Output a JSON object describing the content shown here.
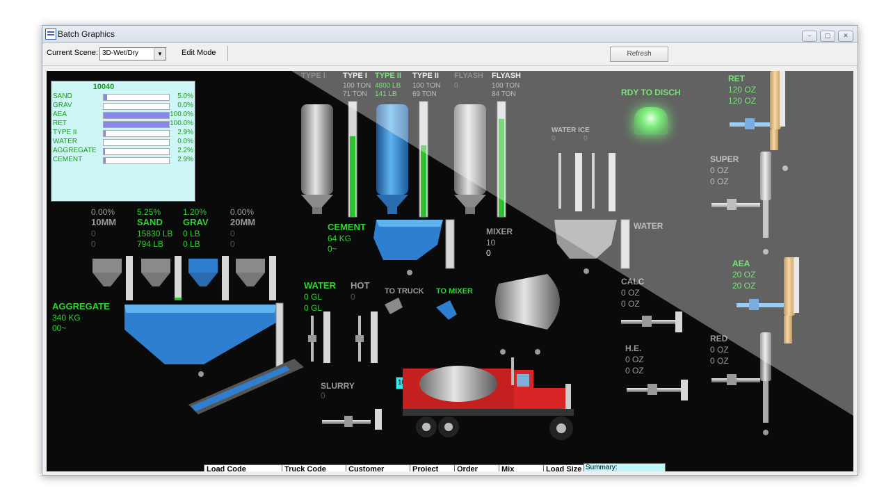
{
  "window": {
    "title": "Batch Graphics",
    "btn_min": "‒",
    "btn_max": "▢",
    "btn_close": "✕"
  },
  "toolbar": {
    "scene_label": "Current Scene:",
    "scene_value": "3D-Wet/Dry",
    "edit_mode": "Edit Mode",
    "refresh": "Refresh"
  },
  "panel": {
    "batch_number": "10040",
    "rows": [
      {
        "name": "SAND",
        "pct": "5.0%",
        "fill": 0.05
      },
      {
        "name": "GRAV",
        "pct": "0.0%",
        "fill": 0.0
      },
      {
        "name": "AEA",
        "pct": "100.0%",
        "fill": 1.0
      },
      {
        "name": "RET",
        "pct": "100.0%",
        "fill": 1.0
      },
      {
        "name": "TYPE II",
        "pct": "2.9%",
        "fill": 0.029
      },
      {
        "name": "WATER",
        "pct": "0.0%",
        "fill": 0.0
      },
      {
        "name": "AGGREGATE",
        "pct": "2.2%",
        "fill": 0.022
      },
      {
        "name": "CEMENT",
        "pct": "2.9%",
        "fill": 0.029
      }
    ]
  },
  "aggregates": [
    {
      "pct": "0.00%",
      "name": "10MM",
      "v1": "0",
      "v2": "0",
      "active": false
    },
    {
      "pct": "5.25%",
      "name": "SAND",
      "v1": "15830 LB",
      "v2": "794 LB",
      "active": true
    },
    {
      "pct": "1.20%",
      "name": "GRAV",
      "v1": "0 LB",
      "v2": "0 LB",
      "active": true
    },
    {
      "pct": "0.00%",
      "name": "20MM",
      "v1": "0",
      "v2": "0",
      "active": false
    }
  ],
  "aggregate_total": {
    "label": "AGGREGATE",
    "weight": "340 KG",
    "extra": "00~"
  },
  "silos": [
    {
      "name": "TYPE I",
      "cap": "",
      "wt": "",
      "active": false,
      "dim": true
    },
    {
      "name": "TYPE I",
      "cap": "100 TON",
      "wt": "71 TON",
      "active": false,
      "dim": false
    },
    {
      "name": "TYPE II",
      "cap": "4800 LB",
      "wt": "141 LB",
      "active": true,
      "dim": false
    },
    {
      "name": "TYPE II",
      "cap": "100 TON",
      "wt": "69 TON",
      "active": false,
      "dim": false
    },
    {
      "name": "FLYASH",
      "cap": "0",
      "wt": "",
      "active": false,
      "dim": true
    },
    {
      "name": "FLYASH",
      "cap": "100 TON",
      "wt": "84 TON",
      "active": false,
      "dim": false
    }
  ],
  "silo_levels": [
    0.7,
    0.62,
    0.85
  ],
  "cement": {
    "label": "CEMENT",
    "weight": "64 KG",
    "extra": "0~"
  },
  "mixer": {
    "label": "MIXER",
    "v1": "10",
    "v2": "0"
  },
  "water": {
    "label": "WATER",
    "v1": "0 GL",
    "v2": "0 GL",
    "hot_label": "HOT",
    "hot_val": "0"
  },
  "chutes": {
    "to_truck": "TO TRUCK",
    "to_mixer": "TO MIXER"
  },
  "slurry": {
    "label": "SLURRY",
    "val": "0"
  },
  "water_ice": {
    "label": "WATER ICE",
    "v1": "0",
    "v2": "0"
  },
  "water_hopper": {
    "label": "WATER"
  },
  "ready": {
    "label": "RDY TO DISCH"
  },
  "admix": [
    {
      "name": "RET",
      "v1": "120 OZ",
      "v2": "120 OZ",
      "active": true
    },
    {
      "name": "SUPER",
      "v1": "0 OZ",
      "v2": "0 OZ",
      "active": false
    },
    {
      "name": "AEA",
      "v1": "20 OZ",
      "v2": "20 OZ",
      "active": true
    },
    {
      "name": "RED",
      "v1": "0 OZ",
      "v2": "0 OZ",
      "active": false
    },
    {
      "name": "CALC",
      "v1": "0 OZ",
      "v2": "0 OZ",
      "active": false
    },
    {
      "name": "H.E.",
      "v1": "0 OZ",
      "v2": "0 OZ",
      "active": false
    }
  ],
  "truck_input": {
    "value": "100"
  },
  "table": {
    "headers": [
      "Load Code",
      "Truck Code",
      "Customer",
      "Project",
      "Order",
      "Mix",
      "Load Size"
    ],
    "summary": "Summary:"
  },
  "colors": {
    "accent_green": "#2fd42f",
    "hopper_blue": "#2f7fd0",
    "scene_bg": "#0a0a0a"
  }
}
